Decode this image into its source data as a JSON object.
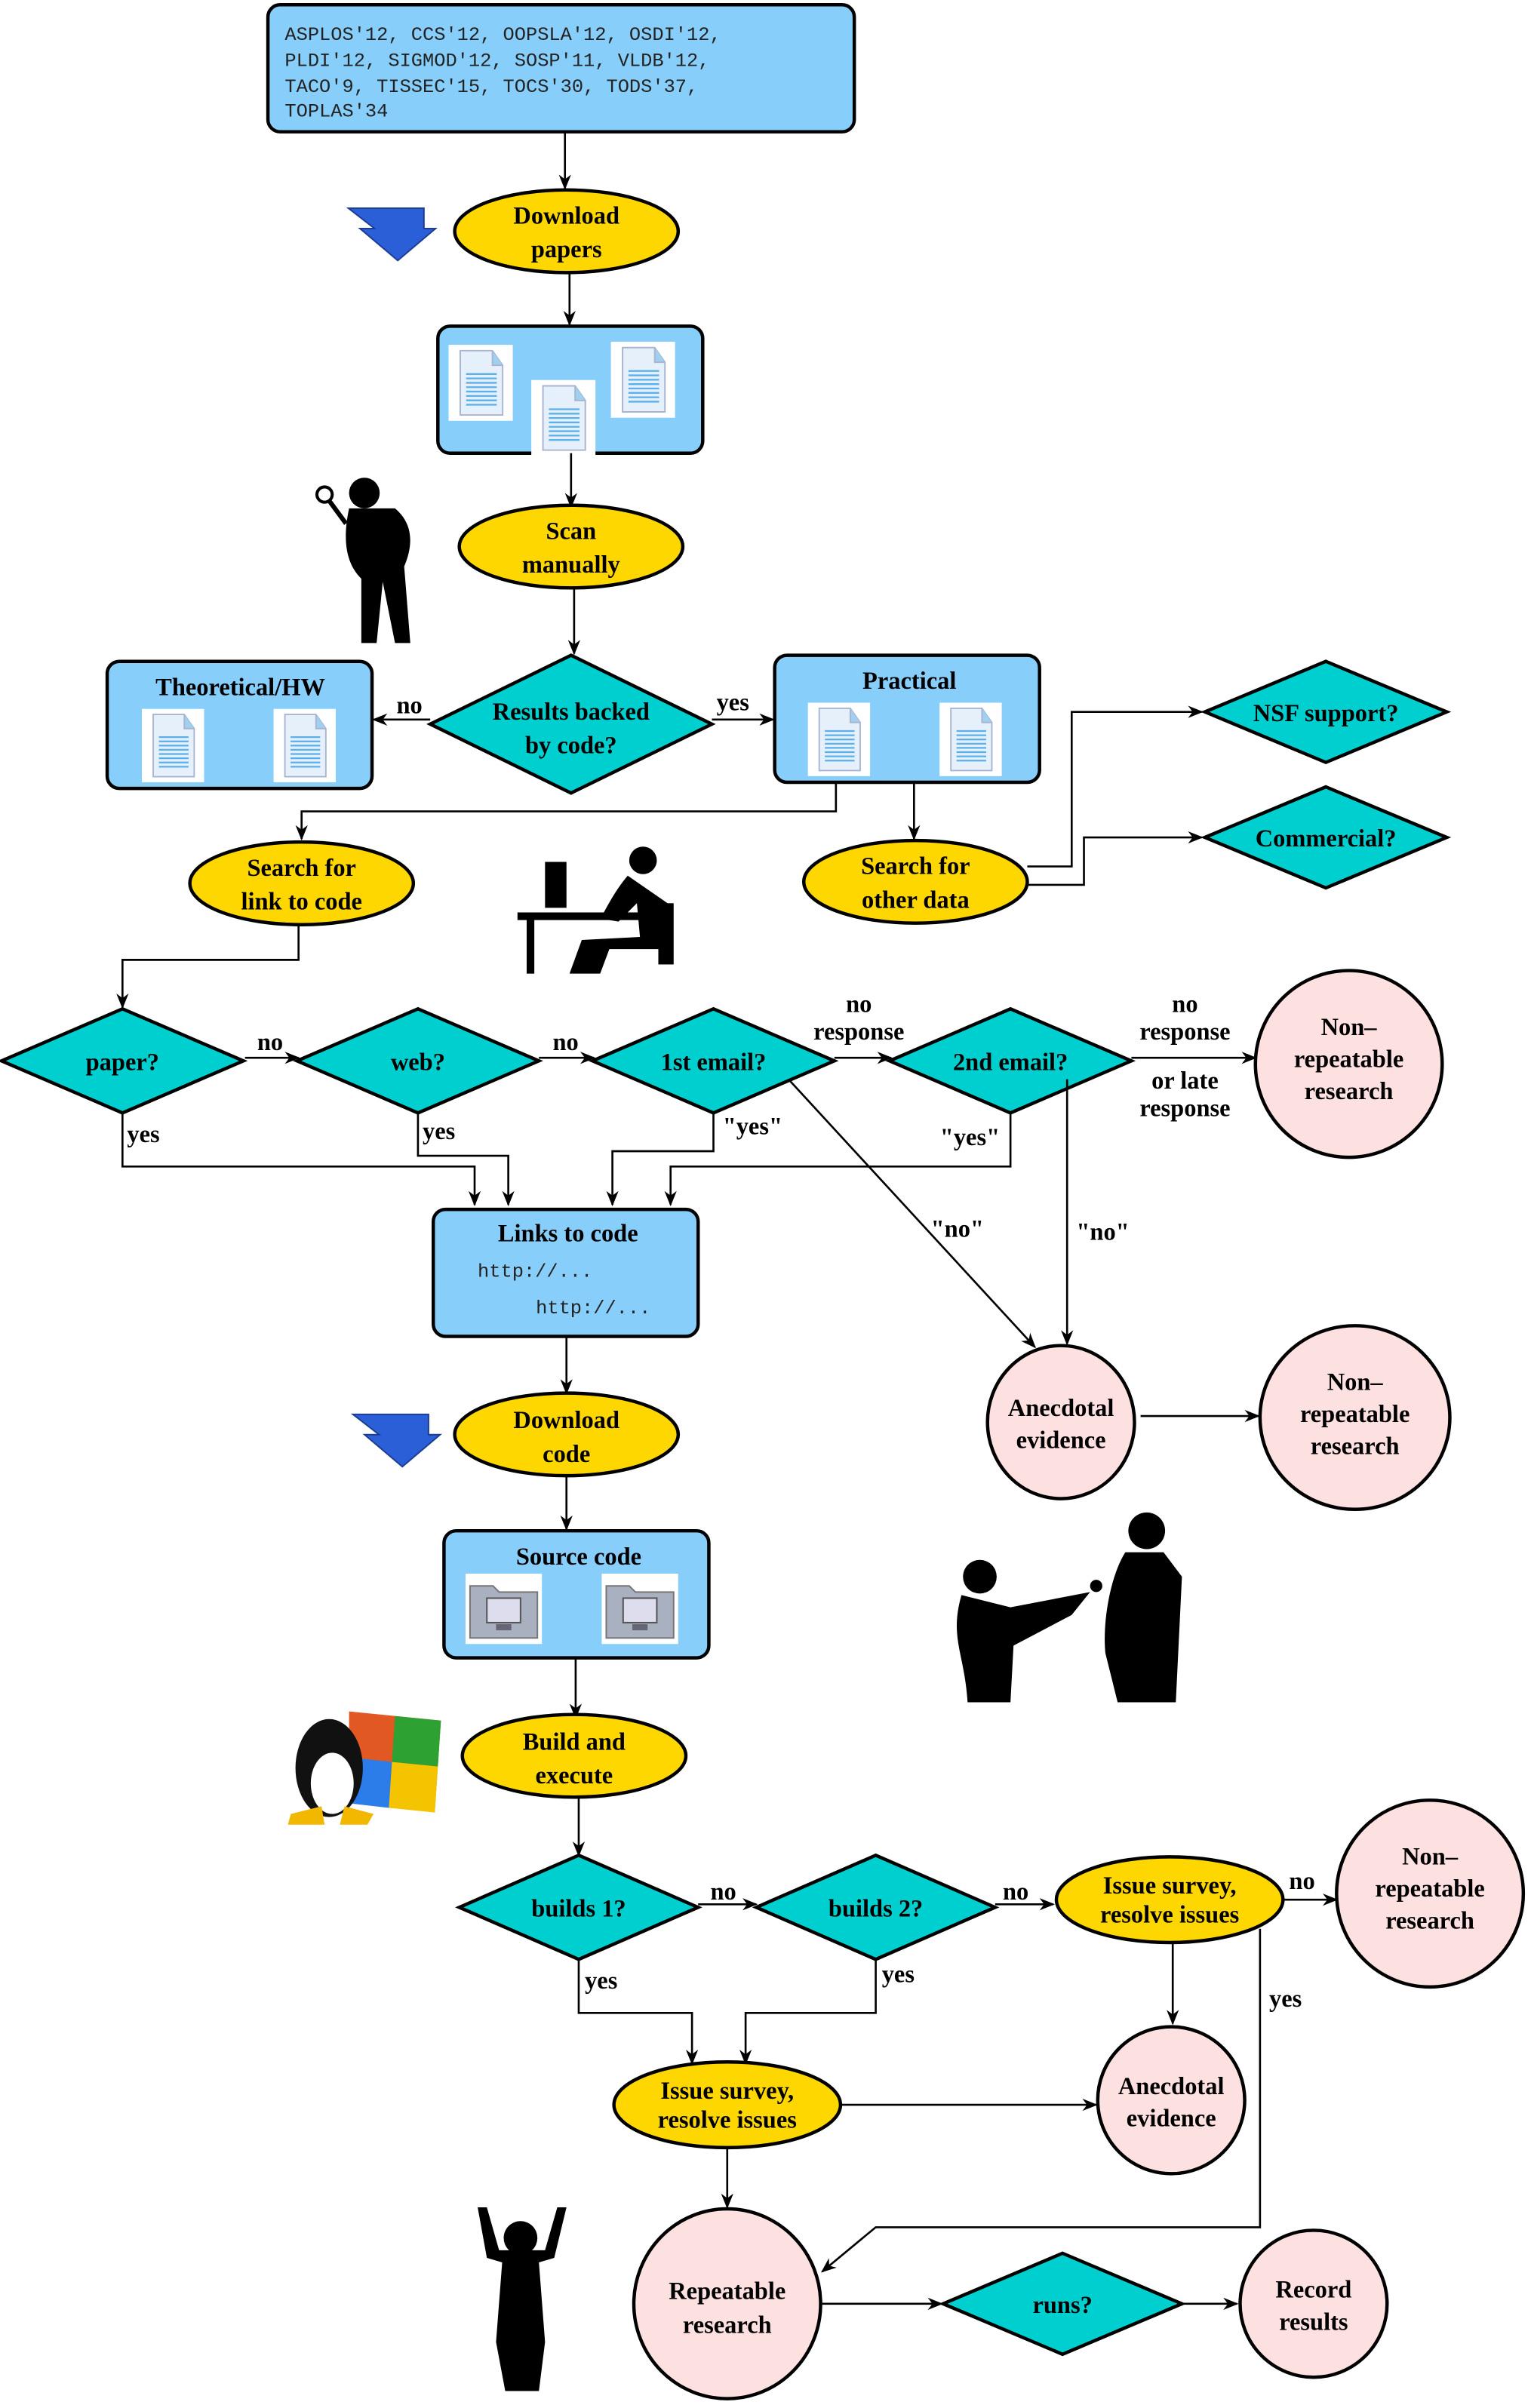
{
  "venues": [
    "ASPLOS'12, CCS'12, OOPSLA'12, OSDI'12,",
    "PLDI'12, SIGMOD'12, SOSP'11, VLDB'12,",
    "TACO'9, TISSEC'15, TOCS'30, TODS'37,",
    "TOPLAS'34"
  ],
  "nodes": {
    "download_papers": [
      "Download",
      "papers"
    ],
    "scan": [
      "Scan",
      "manually"
    ],
    "results_backed": [
      "Results backed",
      "by code?"
    ],
    "theoretical": "Theoretical/HW",
    "practical": "Practical",
    "search_link": [
      "Search for",
      "link to code"
    ],
    "search_other": [
      "Search for",
      "other data"
    ],
    "nsf": "NSF support?",
    "commercial": "Commercial?",
    "paper": "paper?",
    "web": "web?",
    "email1": "1st email?",
    "email2": "2nd email?",
    "nonrep": [
      "Non–",
      "repeatable",
      "research"
    ],
    "links": "Links to code",
    "url": "http://...",
    "anecdotal": [
      "Anecdotal",
      "evidence"
    ],
    "download_code": [
      "Download",
      "code"
    ],
    "source": "Source code",
    "build": [
      "Build and",
      "execute"
    ],
    "builds1": "builds 1?",
    "builds2": "builds 2?",
    "survey": [
      "Issue survey,",
      "resolve issues"
    ],
    "repeatable": [
      "Repeatable",
      "research"
    ],
    "runs": "runs?",
    "record": [
      "Record",
      "results"
    ]
  },
  "edges": {
    "no": "no",
    "yes": "yes",
    "qyes": "\"yes\"",
    "qno": "\"no\"",
    "no_response": [
      "no",
      "response"
    ],
    "late": [
      "or late",
      "response"
    ]
  },
  "colors": {
    "box": "#87cefa",
    "process": "#ffd700",
    "decision": "#00cfcf",
    "terminal": "#fde0e0"
  }
}
